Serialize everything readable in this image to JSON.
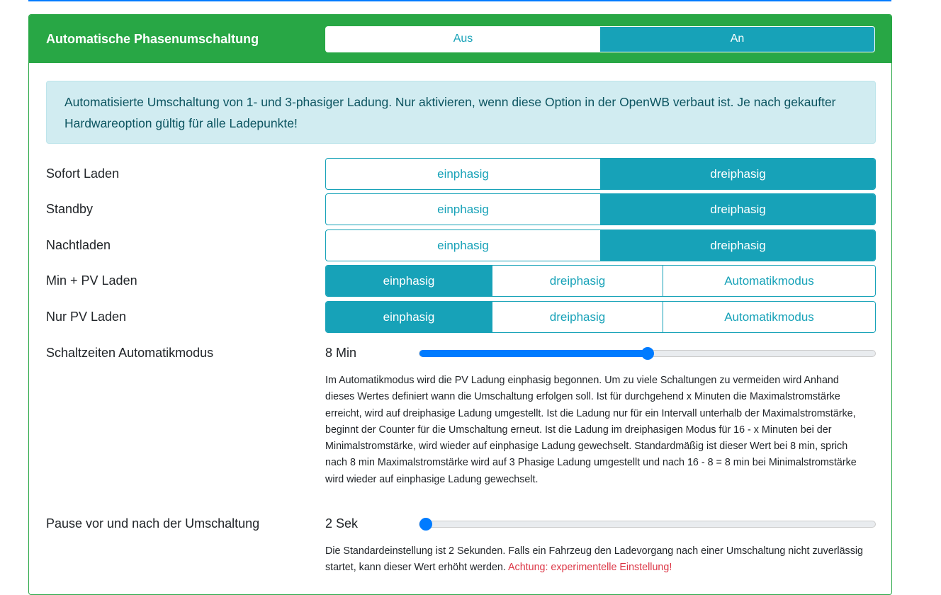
{
  "header": {
    "title": "Automatische Phasenumschaltung",
    "options": [
      "Aus",
      "An"
    ],
    "selected": 1
  },
  "alert": "Automatisierte Umschaltung von 1- und 3-phasiger Ladung. Nur aktivieren, wenn diese Option in der OpenWB verbaut ist. Je nach gekaufter Hardwareoption gültig für alle Ladepunkte!",
  "rows": [
    {
      "label": "Sofort Laden",
      "options": [
        "einphasig",
        "dreiphasig"
      ],
      "selected": 1
    },
    {
      "label": "Standby",
      "options": [
        "einphasig",
        "dreiphasig"
      ],
      "selected": 1
    },
    {
      "label": "Nachtladen",
      "options": [
        "einphasig",
        "dreiphasig"
      ],
      "selected": 1
    },
    {
      "label": "Min + PV Laden",
      "options": [
        "einphasig",
        "dreiphasig",
        "Automatikmodus"
      ],
      "selected": 0
    },
    {
      "label": "Nur PV Laden",
      "options": [
        "einphasig",
        "dreiphasig",
        "Automatikmodus"
      ],
      "selected": 0
    }
  ],
  "switch_time": {
    "label": "Schaltzeiten Automatikmodus",
    "value_text": "8 Min",
    "fraction": 0.5,
    "help": "Im Automatikmodus wird die PV Ladung einphasig begonnen. Um zu viele Schaltungen zu vermeiden wird Anhand dieses Wertes definiert wann die Umschaltung erfolgen soll. Ist für durchgehend x Minuten die Maximalstromstärke erreicht, wird auf dreiphasige Ladung umgestellt. Ist die Ladung nur für ein Intervall unterhalb der Maximalstromstärke, beginnt der Counter für die Umschaltung erneut. Ist die Ladung im dreiphasigen Modus für 16 - x Minuten bei der Minimalstromstärke, wird wieder auf einphasige Ladung gewechselt. Standardmäßig ist dieser Wert bei 8 min, sprich nach 8 min Maximalstromstärke wird auf 3 Phasige Ladung umgestellt und nach 16 - 8 = 8 min bei Minimalstromstärke wird wieder auf einphasige Ladung gewechselt."
  },
  "pause": {
    "label": "Pause vor und nach der Umschaltung",
    "value_text": "2 Sek",
    "fraction": 0,
    "help": "Die Standardeinstellung ist 2 Sekunden. Falls ein Fahrzeug den Ladevorgang nach einer Umschaltung nicht zuverlässig startet, kann dieser Wert erhöht werden.",
    "warning": "Achtung: experimentelle Einstellung!"
  }
}
